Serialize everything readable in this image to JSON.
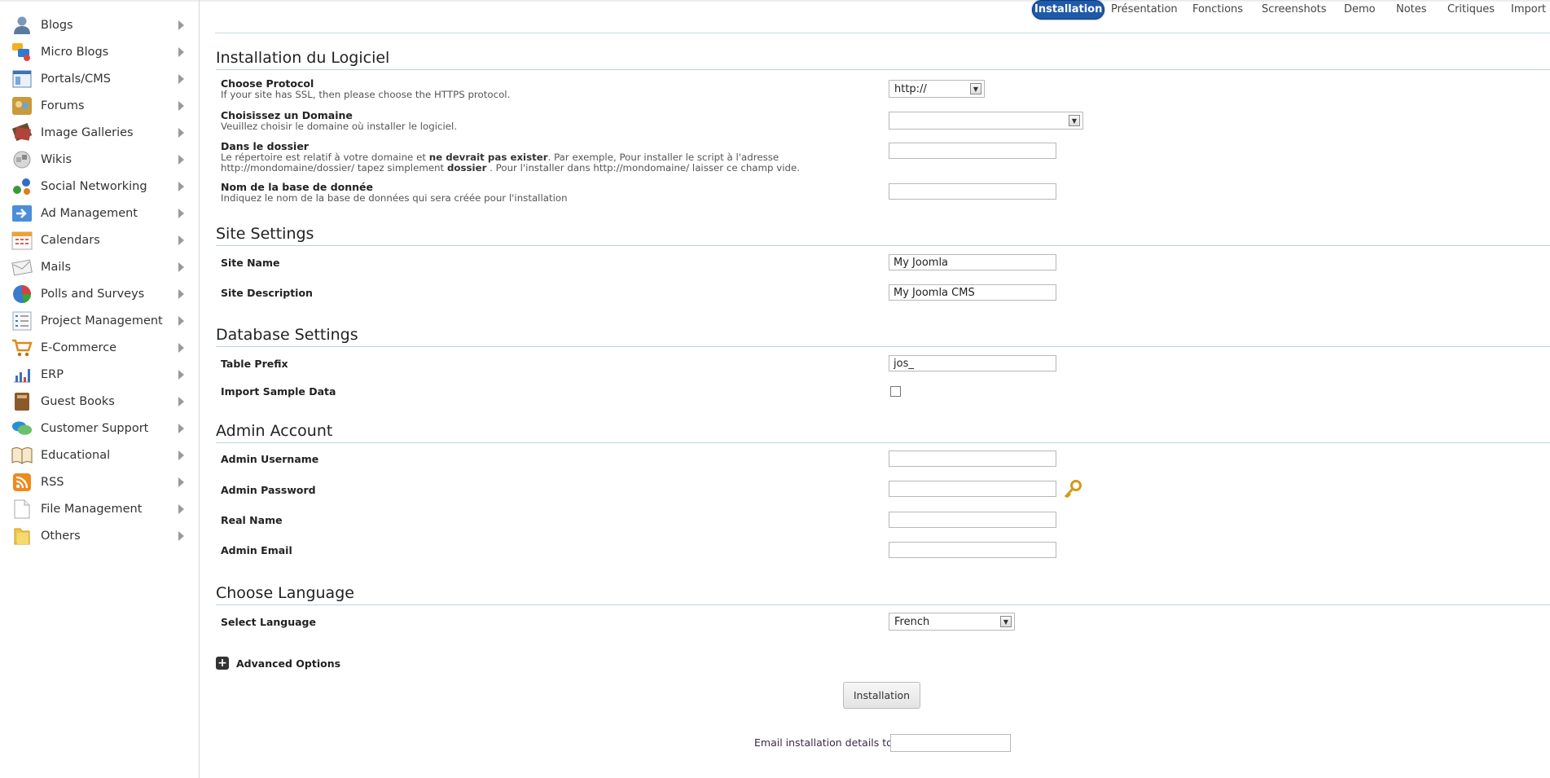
{
  "sidebar": {
    "items": [
      {
        "label": "Blogs",
        "icon": "user-icon"
      },
      {
        "label": "Micro Blogs",
        "icon": "chat-bubbles-icon"
      },
      {
        "label": "Portals/CMS",
        "icon": "window-icon"
      },
      {
        "label": "Forums",
        "icon": "people-icon"
      },
      {
        "label": "Image Galleries",
        "icon": "pictures-icon"
      },
      {
        "label": "Wikis",
        "icon": "puzzle-icon"
      },
      {
        "label": "Social Networking",
        "icon": "network-icon"
      },
      {
        "label": "Ad Management",
        "icon": "arrow-board-icon"
      },
      {
        "label": "Calendars",
        "icon": "calendar-icon"
      },
      {
        "label": "Mails",
        "icon": "envelope-icon"
      },
      {
        "label": "Polls and Surveys",
        "icon": "pie-chart-icon"
      },
      {
        "label": "Project Management",
        "icon": "checklist-icon"
      },
      {
        "label": "E-Commerce",
        "icon": "cart-icon"
      },
      {
        "label": "ERP",
        "icon": "bar-chart-icon"
      },
      {
        "label": "Guest Books",
        "icon": "book-icon"
      },
      {
        "label": "Customer Support",
        "icon": "support-bubbles-icon"
      },
      {
        "label": "Educational",
        "icon": "open-book-icon"
      },
      {
        "label": "RSS",
        "icon": "rss-icon"
      },
      {
        "label": "File Management",
        "icon": "file-icon"
      },
      {
        "label": "Others",
        "icon": "folder-icon"
      }
    ]
  },
  "tabs": [
    "Installation",
    "Présentation",
    "Fonctions",
    "Screenshots",
    "Demo",
    "Notes",
    "Critiques",
    "Import"
  ],
  "software_install": {
    "title": "Installation du Logiciel",
    "protocol": {
      "label": "Choose Protocol",
      "help": "If your site has SSL, then please choose the HTTPS protocol.",
      "value": "http://"
    },
    "domain": {
      "label": "Choisissez un Domaine",
      "help": "Veuillez choisir le domaine où installer le logiciel.",
      "value": ""
    },
    "directory": {
      "label": "Dans le dossier",
      "help_1": "Le répertoire est relatif à votre domaine et ",
      "help_bold_1": "ne devrait pas exister",
      "help_2": ". Par exemple, Pour installer le script à l'adresse",
      "help_3": "http://mondomaine/dossier/ tapez simplement ",
      "help_bold_2": "dossier",
      "help_4": " . Pour l'installer dans http://mondomaine/ laisser ce champ vide.",
      "value": ""
    },
    "database": {
      "label": "Nom de la base de donnée",
      "help": "Indiquez le nom de la base de données qui sera créée pour l'installation",
      "value": ""
    }
  },
  "site_settings": {
    "title": "Site Settings",
    "site_name": {
      "label": "Site Name",
      "value": "My Joomla"
    },
    "site_description": {
      "label": "Site Description",
      "value": "My Joomla CMS"
    }
  },
  "database_settings": {
    "title": "Database Settings",
    "table_prefix": {
      "label": "Table Prefix",
      "value": "jos_"
    },
    "import_sample": {
      "label": "Import Sample Data",
      "checked": false
    }
  },
  "admin_account": {
    "title": "Admin Account",
    "username": {
      "label": "Admin Username",
      "value": ""
    },
    "password": {
      "label": "Admin Password",
      "value": ""
    },
    "real_name": {
      "label": "Real Name",
      "value": ""
    },
    "email": {
      "label": "Admin Email",
      "value": ""
    }
  },
  "language": {
    "title": "Choose Language",
    "select": {
      "label": "Select Language",
      "value": "French"
    }
  },
  "advanced_options_label": "Advanced Options",
  "install_button": "Installation",
  "email_details": {
    "label": "Email installation details to :",
    "value": ""
  },
  "colors": {
    "accent": "#1e5aa8",
    "rule": "#b9d3e0"
  }
}
